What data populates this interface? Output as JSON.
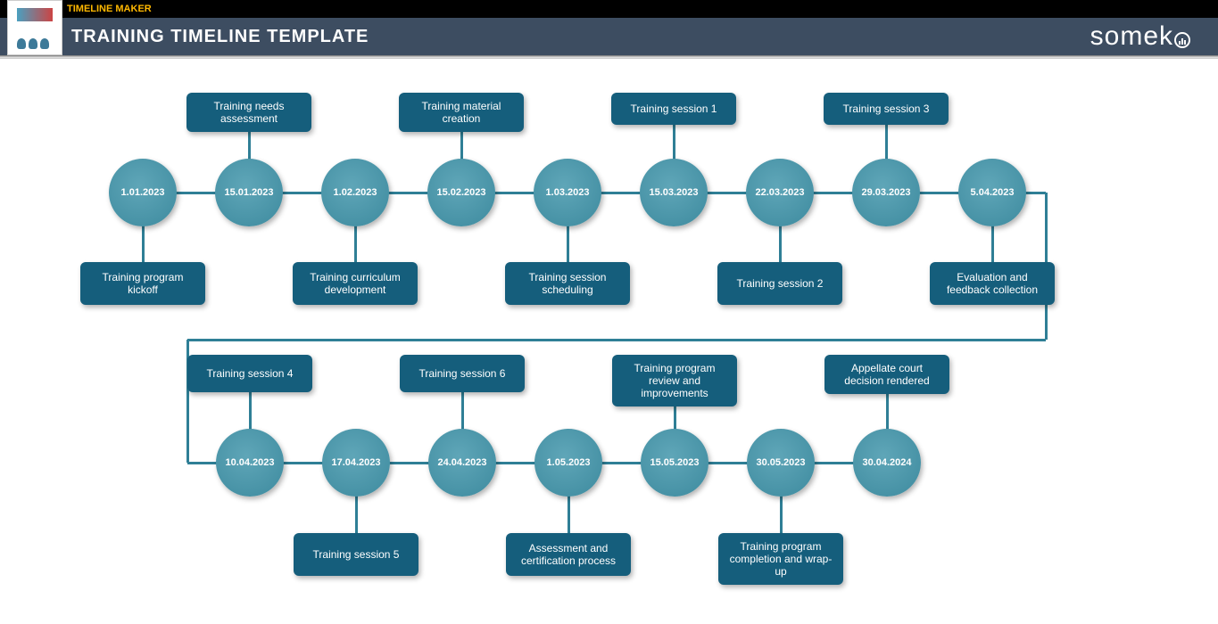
{
  "header": {
    "breadcrumb": "TIMELINE MAKER",
    "title": "TRAINING TIMELINE TEMPLATE",
    "brand": "someka"
  },
  "colors": {
    "node_fill": "#4b97aa",
    "label_fill": "#155e7c",
    "connector": "#2f7f96"
  },
  "chart_data": {
    "type": "timeline",
    "rows": [
      {
        "nodes": [
          {
            "date": "1.01.2023",
            "label": "Training program kickoff",
            "label_pos": "below"
          },
          {
            "date": "15.01.2023",
            "label": "Training needs assessment",
            "label_pos": "above"
          },
          {
            "date": "1.02.2023",
            "label": "Training curriculum development",
            "label_pos": "below"
          },
          {
            "date": "15.02.2023",
            "label": "Training material creation",
            "label_pos": "above"
          },
          {
            "date": "1.03.2023",
            "label": "Training session scheduling",
            "label_pos": "below"
          },
          {
            "date": "15.03.2023",
            "label": "Training session 1",
            "label_pos": "above"
          },
          {
            "date": "22.03.2023",
            "label": "Training session 2",
            "label_pos": "below"
          },
          {
            "date": "29.03.2023",
            "label": "Training session 3",
            "label_pos": "above"
          },
          {
            "date": "5.04.2023",
            "label": "Evaluation and feedback collection",
            "label_pos": "below"
          }
        ]
      },
      {
        "nodes": [
          {
            "date": "10.04.2023",
            "label": "Training session 4",
            "label_pos": "above"
          },
          {
            "date": "17.04.2023",
            "label": "Training session 5",
            "label_pos": "below"
          },
          {
            "date": "24.04.2023",
            "label": "Training session 6",
            "label_pos": "above"
          },
          {
            "date": "1.05.2023",
            "label": "Assessment and certification process",
            "label_pos": "below"
          },
          {
            "date": "15.05.2023",
            "label": "Training program review and improvements",
            "label_pos": "above"
          },
          {
            "date": "30.05.2023",
            "label": "Training program completion and wrap-up",
            "label_pos": "below"
          },
          {
            "date": "30.04.2024",
            "label": "Appellate court decision rendered",
            "label_pos": "above"
          }
        ]
      }
    ]
  }
}
